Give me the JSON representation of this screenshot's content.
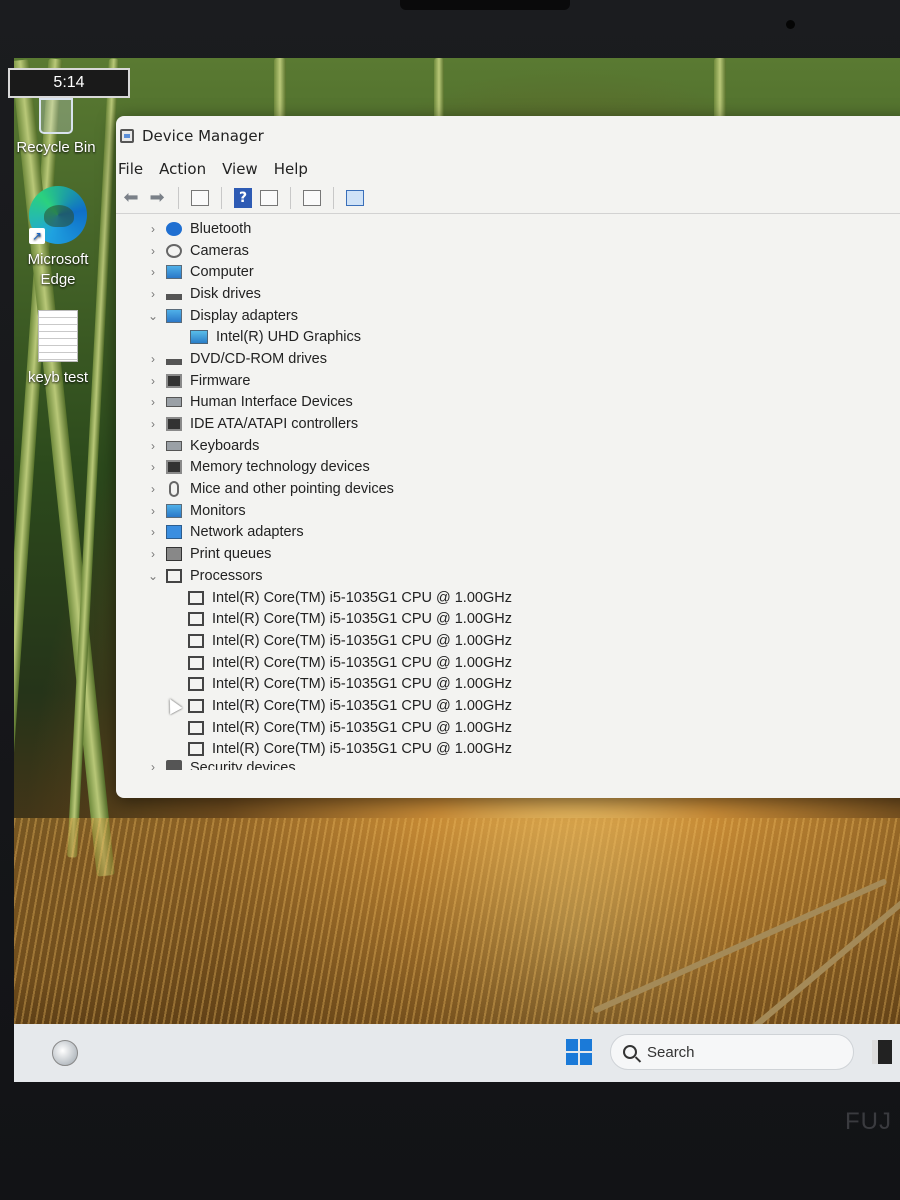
{
  "clock": {
    "time": "5:14"
  },
  "desktop": {
    "icons": [
      {
        "label": "Recycle Bin"
      },
      {
        "label": "Microsoft Edge"
      },
      {
        "label": "keyb test"
      }
    ]
  },
  "window": {
    "title": "Device Manager",
    "menu": [
      "File",
      "Action",
      "View",
      "Help"
    ],
    "tree": [
      {
        "label": "Bluetooth",
        "icon": "bluetooth-icon",
        "expanded": false
      },
      {
        "label": "Cameras",
        "icon": "camera-icon",
        "expanded": false
      },
      {
        "label": "Computer",
        "icon": "monitor-icon",
        "expanded": false
      },
      {
        "label": "Disk drives",
        "icon": "disk-drive-icon",
        "expanded": false
      },
      {
        "label": "Display adapters",
        "icon": "display-adapter-icon",
        "expanded": true,
        "children": [
          "Intel(R) UHD Graphics"
        ]
      },
      {
        "label": "DVD/CD-ROM drives",
        "icon": "dvd-drive-icon",
        "expanded": false
      },
      {
        "label": "Firmware",
        "icon": "firmware-icon",
        "expanded": false
      },
      {
        "label": "Human Interface Devices",
        "icon": "hid-icon",
        "expanded": false
      },
      {
        "label": "IDE ATA/ATAPI controllers",
        "icon": "ide-controller-icon",
        "expanded": false
      },
      {
        "label": "Keyboards",
        "icon": "keyboard-icon",
        "expanded": false
      },
      {
        "label": "Memory technology devices",
        "icon": "memory-icon",
        "expanded": false
      },
      {
        "label": "Mice and other pointing devices",
        "icon": "mouse-icon",
        "expanded": false
      },
      {
        "label": "Monitors",
        "icon": "monitor-icon",
        "expanded": false
      },
      {
        "label": "Network adapters",
        "icon": "network-adapter-icon",
        "expanded": false
      },
      {
        "label": "Print queues",
        "icon": "printer-icon",
        "expanded": false
      },
      {
        "label": "Processors",
        "icon": "processor-icon",
        "expanded": true,
        "children": [
          "Intel(R) Core(TM) i5-1035G1 CPU @ 1.00GHz",
          "Intel(R) Core(TM) i5-1035G1 CPU @ 1.00GHz",
          "Intel(R) Core(TM) i5-1035G1 CPU @ 1.00GHz",
          "Intel(R) Core(TM) i5-1035G1 CPU @ 1.00GHz",
          "Intel(R) Core(TM) i5-1035G1 CPU @ 1.00GHz",
          "Intel(R) Core(TM) i5-1035G1 CPU @ 1.00GHz",
          "Intel(R) Core(TM) i5-1035G1 CPU @ 1.00GHz",
          "Intel(R) Core(TM) i5-1035G1 CPU @ 1.00GHz"
        ]
      },
      {
        "label": "Security devices",
        "icon": "security-device-icon",
        "expanded": false
      }
    ]
  },
  "taskbar": {
    "search_label": "Search"
  },
  "bezel": {
    "brand": "FUJ"
  }
}
